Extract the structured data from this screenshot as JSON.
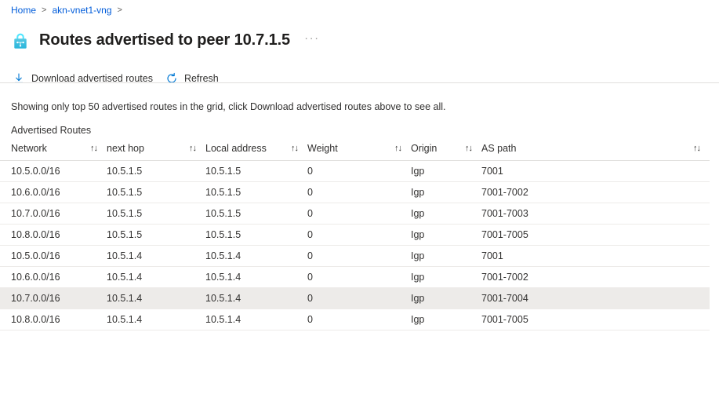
{
  "breadcrumb": {
    "items": [
      {
        "label": "Home",
        "link": true
      },
      {
        "label": "akn-vnet1-vng",
        "link": true
      }
    ],
    "separator": ">"
  },
  "header": {
    "icon": "vpn-gateway-lock-icon",
    "title": "Routes advertised to peer 10.7.1.5",
    "more_menu": "···"
  },
  "toolbar": {
    "download_label": "Download advertised routes",
    "download_icon": "download-icon",
    "refresh_label": "Refresh",
    "refresh_icon": "refresh-icon"
  },
  "notice": {
    "text": "Showing only top 50 advertised routes in the grid, click Download advertised routes above to see all."
  },
  "section": {
    "label": "Advertised Routes"
  },
  "table": {
    "columns": [
      {
        "label": "Network",
        "sort": "↑↓"
      },
      {
        "label": "next hop",
        "sort": "↑↓"
      },
      {
        "label": "Local address",
        "sort": "↑↓"
      },
      {
        "label": "Weight",
        "sort": "↑↓"
      },
      {
        "label": "Origin",
        "sort": "↑↓"
      },
      {
        "label": "AS path",
        "sort": "↑↓"
      }
    ],
    "rows": [
      {
        "network": "10.5.0.0/16",
        "next_hop": "10.5.1.5",
        "local_address": "10.5.1.5",
        "weight": "0",
        "origin": "Igp",
        "as_path": "7001",
        "highlighted": false
      },
      {
        "network": "10.6.0.0/16",
        "next_hop": "10.5.1.5",
        "local_address": "10.5.1.5",
        "weight": "0",
        "origin": "Igp",
        "as_path": "7001-7002",
        "highlighted": false
      },
      {
        "network": "10.7.0.0/16",
        "next_hop": "10.5.1.5",
        "local_address": "10.5.1.5",
        "weight": "0",
        "origin": "Igp",
        "as_path": "7001-7003",
        "highlighted": false
      },
      {
        "network": "10.8.0.0/16",
        "next_hop": "10.5.1.5",
        "local_address": "10.5.1.5",
        "weight": "0",
        "origin": "Igp",
        "as_path": "7001-7005",
        "highlighted": false
      },
      {
        "network": "10.5.0.0/16",
        "next_hop": "10.5.1.4",
        "local_address": "10.5.1.4",
        "weight": "0",
        "origin": "Igp",
        "as_path": "7001",
        "highlighted": false
      },
      {
        "network": "10.6.0.0/16",
        "next_hop": "10.5.1.4",
        "local_address": "10.5.1.4",
        "weight": "0",
        "origin": "Igp",
        "as_path": "7001-7002",
        "highlighted": false
      },
      {
        "network": "10.7.0.0/16",
        "next_hop": "10.5.1.4",
        "local_address": "10.5.1.4",
        "weight": "0",
        "origin": "Igp",
        "as_path": "7001-7004",
        "highlighted": true
      },
      {
        "network": "10.8.0.0/16",
        "next_hop": "10.5.1.4",
        "local_address": "10.5.1.4",
        "weight": "0",
        "origin": "Igp",
        "as_path": "7001-7005",
        "highlighted": false
      }
    ]
  },
  "colors": {
    "link": "#015cda",
    "accent": "#0078d4",
    "icon_cyan": "#32bedd",
    "row_highlight": "#edebe9",
    "border": "#e1dfdd",
    "text": "#323130"
  }
}
